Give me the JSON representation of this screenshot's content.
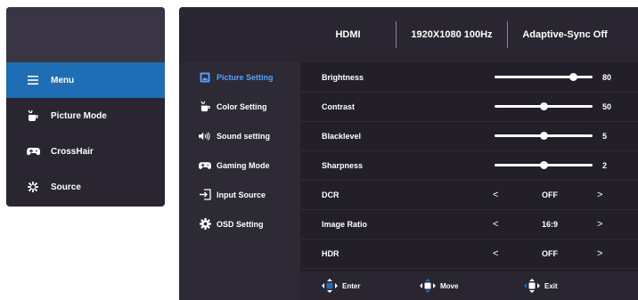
{
  "quick_menu": {
    "items": [
      {
        "label": "Menu",
        "icon": "hamburger-icon",
        "active": true
      },
      {
        "label": "Picture Mode",
        "icon": "picture-mode-icon",
        "active": false
      },
      {
        "label": "CrossHair",
        "icon": "gamepad-icon",
        "active": false
      },
      {
        "label": "Source",
        "icon": "source-icon",
        "active": false
      }
    ]
  },
  "header": {
    "input": "HDMI",
    "resolution": "1920X1080 100Hz",
    "sync": "Adaptive-Sync Off"
  },
  "nav": {
    "items": [
      {
        "label": "Picture Setting",
        "icon": "picture-setting-icon",
        "active": true
      },
      {
        "label": "Color Setting",
        "icon": "color-setting-icon",
        "active": false
      },
      {
        "label": "Sound setting",
        "icon": "speaker-icon",
        "active": false
      },
      {
        "label": "Gaming Mode",
        "icon": "gamepad-icon",
        "active": false
      },
      {
        "label": "Input Source",
        "icon": "input-source-icon",
        "active": false
      },
      {
        "label": "OSD Setting",
        "icon": "gear-icon",
        "active": false
      }
    ]
  },
  "settings": {
    "brightness": {
      "label": "Brightness",
      "value": "80",
      "level": 0.8
    },
    "contrast": {
      "label": "Contrast",
      "value": "50",
      "level": 0.5
    },
    "blacklevel": {
      "label": "Blacklevel",
      "value": "5",
      "level": 0.5
    },
    "sharpness": {
      "label": "Sharpness",
      "value": "2",
      "level": 0.5
    },
    "dcr": {
      "label": "DCR",
      "value": "OFF"
    },
    "image_ratio": {
      "label": "Image Ratio",
      "value": "16:9"
    },
    "hdr": {
      "label": "HDR",
      "value": "OFF"
    }
  },
  "arrows": {
    "left": "<",
    "right": ">"
  },
  "footer": {
    "enter": "Enter",
    "move": "Move",
    "exit": "Exit"
  },
  "colors": {
    "accent": "#1f6eb5",
    "active_text": "#4da3ff",
    "panel": "#231f29"
  }
}
